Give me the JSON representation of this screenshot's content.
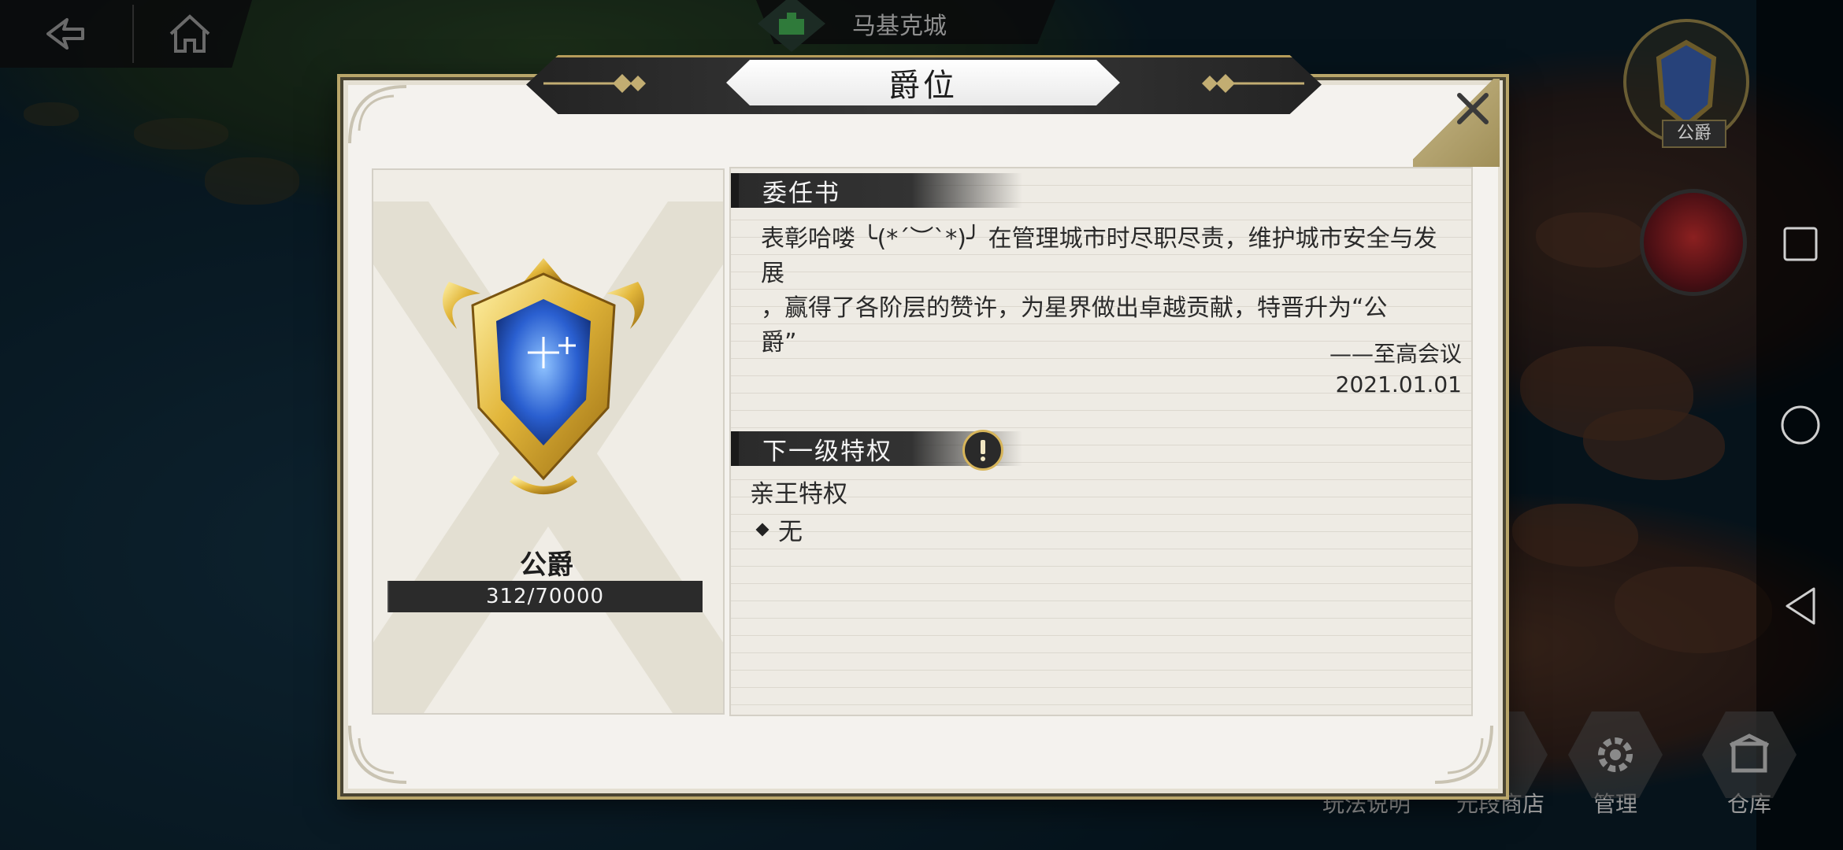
{
  "hud": {
    "back_icon": "back-arrow-icon",
    "home_icon": "home-icon",
    "city_icon": "city-building-icon",
    "city_name": "马基克城"
  },
  "side": {
    "rank_badge_label": "公爵",
    "avatar_icon": "red-hair-character-avatar"
  },
  "bottom_menu": [
    {
      "label": "玩法说明",
      "icon": "scroll-icon"
    },
    {
      "label": "元段商店",
      "icon": "shop-icon"
    },
    {
      "label": "管理",
      "icon": "gear-icon"
    },
    {
      "label": "仓库",
      "icon": "warehouse-icon"
    }
  ],
  "android_nav": [
    "square-recents-icon",
    "circle-home-icon",
    "triangle-back-icon"
  ],
  "modal": {
    "title": "爵位",
    "close_icon": "close-icon",
    "rank": {
      "name": "公爵",
      "progress_text": "312/70000",
      "progress_current": 312,
      "progress_max": 70000,
      "emblem_icon": "gold-crest-blue-gem-emblem"
    },
    "appointment": {
      "heading": "委任书",
      "line1": "表彰哈喽 ╰(*´︶`*)╯ 在管理城市时尽职尽责，维护城市安全与发展",
      "line2": "，赢得了各阶层的赞许，为星界做出卓越贡献，特晋升为“公",
      "line3": "爵”",
      "signature": "——至高会议",
      "date": "2021.01.01"
    },
    "next_privilege": {
      "heading": "下一级特权",
      "warn_icon": "exclamation-icon",
      "title": "亲王特权",
      "items": [
        "无"
      ]
    }
  }
}
